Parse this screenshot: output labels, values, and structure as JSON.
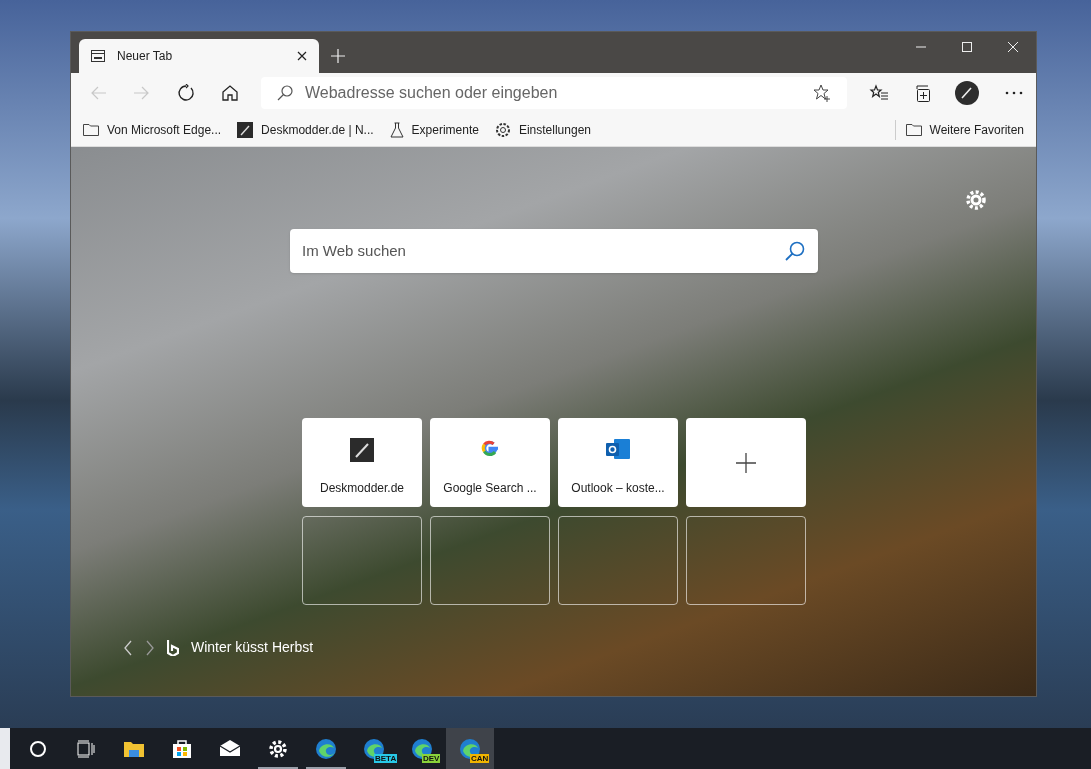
{
  "window": {
    "tabs": [
      {
        "title": "Neuer Tab",
        "selected": true
      }
    ]
  },
  "toolbar": {
    "address_placeholder": "Webadresse suchen oder eingeben",
    "back_disabled": true,
    "forward_disabled": true
  },
  "favorites": [
    {
      "kind": "folder",
      "label": "Von Microsoft Edge..."
    },
    {
      "kind": "site",
      "label": "Deskmodder.de | N..."
    },
    {
      "kind": "flask",
      "label": "Experimente"
    },
    {
      "kind": "gear",
      "label": "Einstellungen"
    }
  ],
  "more_favorites": "Weitere Favoriten",
  "new_tab_page": {
    "search_placeholder": "Im Web suchen",
    "tiles": [
      {
        "kind": "deskmodder",
        "label": "Deskmodder.de"
      },
      {
        "kind": "google",
        "label": "Google Search ..."
      },
      {
        "kind": "outlook",
        "label": "Outlook – koste..."
      },
      {
        "kind": "add"
      },
      {
        "kind": "empty"
      },
      {
        "kind": "empty"
      },
      {
        "kind": "empty"
      },
      {
        "kind": "empty"
      }
    ],
    "image_caption": "Winter küsst Herbst"
  },
  "taskbar": [
    {
      "kind": "cortana",
      "running": false,
      "selected": false
    },
    {
      "kind": "taskview",
      "running": false,
      "selected": false
    },
    {
      "kind": "explorer",
      "running": false,
      "selected": false
    },
    {
      "kind": "store",
      "running": false,
      "selected": false
    },
    {
      "kind": "mail",
      "running": false,
      "selected": false
    },
    {
      "kind": "settings",
      "running": true,
      "selected": false
    },
    {
      "kind": "edge",
      "running": true,
      "selected": false
    },
    {
      "kind": "edge",
      "badge": "BETA",
      "color": "#28c8e8",
      "running": false,
      "selected": false
    },
    {
      "kind": "edge",
      "badge": "DEV",
      "color": "#8ad23a",
      "running": false,
      "selected": false
    },
    {
      "kind": "edge",
      "badge": "CAN",
      "color": "#f0b400",
      "running": false,
      "selected": true
    }
  ]
}
